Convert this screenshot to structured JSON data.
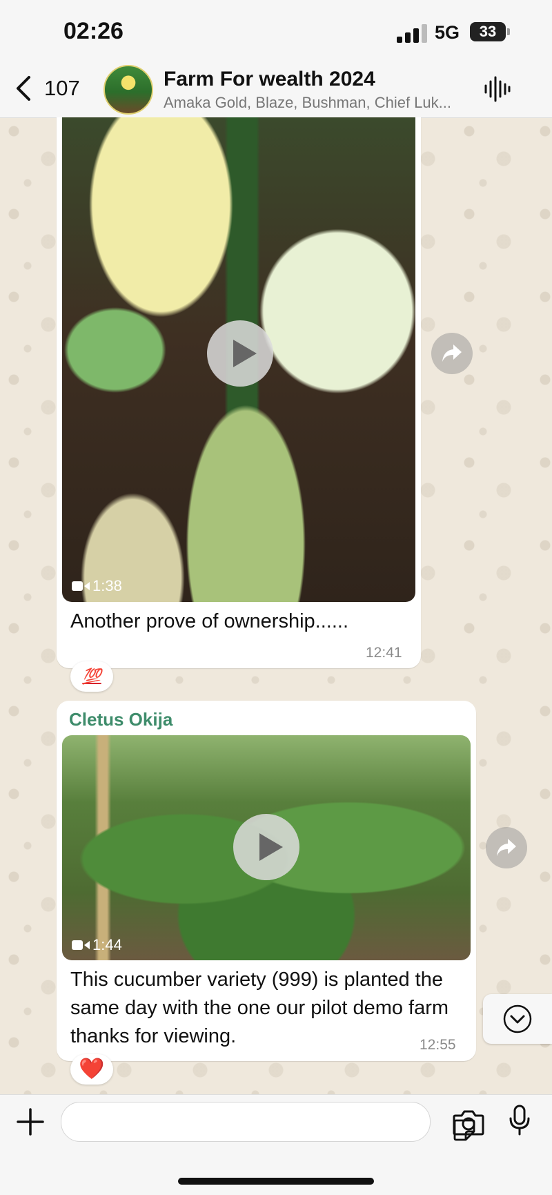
{
  "status_bar": {
    "time": "02:26",
    "network": "5G",
    "battery": "33"
  },
  "header": {
    "back_count": "107",
    "title": "Farm For wealth 2024",
    "subtitle": "Amaka Gold, Blaze, Bushman, Chief Luk...",
    "icons": {
      "back": "chevron-left-icon",
      "audio": "audio-wave-icon"
    }
  },
  "messages": [
    {
      "type": "video",
      "duration": "1:38",
      "caption": "Another prove of ownership......",
      "time": "12:41",
      "reaction": "💯"
    },
    {
      "type": "video",
      "sender": "Cletus Okija",
      "duration": "1:44",
      "caption": "This cucumber variety (999) is  planted the same day with the one our pilot demo farm thanks for viewing.",
      "time": "12:55",
      "reaction": "❤️"
    }
  ],
  "input_bar": {
    "message_value": "",
    "placeholder": ""
  },
  "colors": {
    "sender": "#3e8c6b",
    "background": "#efe8dc",
    "bubble": "#ffffff"
  }
}
